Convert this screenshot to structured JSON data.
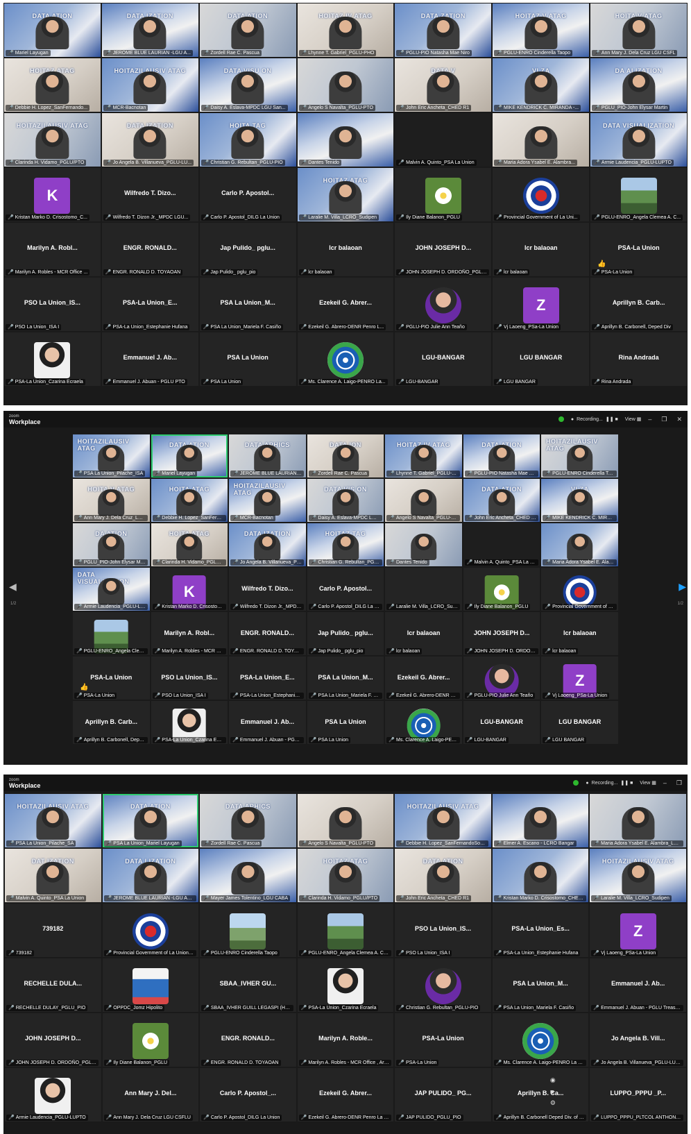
{
  "zoom": {
    "brand_small": "zoom",
    "brand": "Workplace",
    "recording": "Recording...",
    "view": "View"
  },
  "shot1": {
    "tiles": [
      {
        "caption": "Mariel Layugan",
        "banner": "DATA ATION",
        "type": "video"
      },
      {
        "caption": "JEROME BLUE LAURIAN -LGU A...",
        "banner": "DATA IZATION",
        "type": "video"
      },
      {
        "caption": "Zordell Rae C. Pascua",
        "banner": "DATA ATION",
        "type": "video"
      },
      {
        "caption": "Lhynne T. Gabriel_PGLU-PHO",
        "banner": "HOITAZ IV ATAG",
        "type": "video"
      },
      {
        "caption": "PGLU-PIO Natasha Mae Niro",
        "banner": "DATA ZATION",
        "type": "video"
      },
      {
        "caption": "PGLU-ENRO Cinderella Taopo",
        "banner": "HOITAZ V ATAG",
        "type": "video"
      },
      {
        "caption": "Ann Mary J. Dela Cruz LGU CSFL",
        "banner": "HOITA V ATAG",
        "type": "video"
      },
      {
        "caption": "Debbie H. Lopez_SanFernando...",
        "banner": "HOITAZ ATAG",
        "type": "video"
      },
      {
        "caption": "MCR-Bacnotan",
        "banner": "HOITAZILAUSIV ATAG",
        "type": "video"
      },
      {
        "caption": "Daisy A. Eslava-MPDC LGU San...",
        "banner": "DATA VISU ON",
        "type": "video"
      },
      {
        "caption": "Angelo S Navalta_PGLU-PTO",
        "banner": "",
        "type": "video"
      },
      {
        "caption": "John Eric Ancheta_CHED R1",
        "banner": "DATA V",
        "type": "video"
      },
      {
        "caption": "MIKE KENDRICK C. MIRANDA -...",
        "banner": "VI ZA",
        "type": "video"
      },
      {
        "caption": "PGLU_PIO-John Elysar Martin",
        "banner": "DA ALIZATION",
        "type": "video"
      },
      {
        "caption": "Clarinda H. Vidamo_PGLU/PTO",
        "banner": "HOITAZILAUSIV ATAG",
        "type": "video"
      },
      {
        "caption": "Jo Angela B. Villanueva_PGLU-LU...",
        "banner": "DATA IZATION",
        "type": "video"
      },
      {
        "caption": "Christian G. Rebultan_PGLU-PIO",
        "banner": "HOITA TAG",
        "type": "video"
      },
      {
        "caption": "Dantes Tenido",
        "banner": "",
        "type": "video"
      },
      {
        "caption": "Malvin A. Quinto_PSA La Union",
        "banner": "",
        "type": "blank"
      },
      {
        "caption": "Maria Adora Ysabel E. Alambra...",
        "banner": "",
        "type": "video"
      },
      {
        "caption": "Armie Laudencia_PGLU-LUPTO",
        "banner": "DATA VISUALIZATION",
        "type": "video"
      },
      {
        "caption": "Kristan Marko D. Crisostomo_C...",
        "name": "",
        "avatar": "K",
        "type": "letter"
      },
      {
        "caption": "Wilfredo T. Dizon Jr._MPDC LGU...",
        "name": "Wilfredo T. Dizo...",
        "type": "name"
      },
      {
        "caption": "Carlo P. Apostol_DILG La Union",
        "name": "Carlo P. Apostol...",
        "type": "name"
      },
      {
        "caption": "Laralie M. Villa_LCRO_Sudipen",
        "banner": "HOITAZ ATAG",
        "type": "video"
      },
      {
        "caption": "Ily Diane Balanon_PGLU",
        "avatar": "",
        "type": "flower"
      },
      {
        "caption": "Provincial Government of La Uni...",
        "avatar": "",
        "type": "seal"
      },
      {
        "caption": "PGLU-ENRO_Angela Clemea A. C...",
        "avatar": "",
        "type": "landscape"
      },
      {
        "caption": "Marilyn A. Robles - MCR Office ...",
        "name": "Marilyn A. Robl...",
        "type": "name"
      },
      {
        "caption": "ENGR. RONALD D. TOYAOAN",
        "name": "ENGR. RONALD...",
        "type": "name"
      },
      {
        "caption": "Jap Pulido_ pglu_pio",
        "name": "Jap Pulido_ pglu...",
        "type": "name"
      },
      {
        "caption": "lcr balaoan",
        "name": "lcr balaoan",
        "type": "name"
      },
      {
        "caption": "JOHN JOSEPH D. ORDOÑO_PGLU/P...",
        "name": "JOHN JOSEPH D...",
        "type": "name"
      },
      {
        "caption": "lcr balaoan",
        "name": "lcr balaoan",
        "type": "name"
      },
      {
        "caption": "PSA-La Union",
        "name": "PSA-La Union",
        "type": "name",
        "emoji": "👍"
      },
      {
        "caption": "PSO La Union_ISA I",
        "name": "PSO La Union_IS...",
        "type": "name"
      },
      {
        "caption": "PSA-La Union_Estephanie Hufana",
        "name": "PSA-La Union_E...",
        "type": "name"
      },
      {
        "caption": "PSA La Union_Mariela F. Casiño",
        "name": "PSA La Union_M...",
        "type": "name"
      },
      {
        "caption": "Ezekeil G. Abrero-DENR Penro L...",
        "name": "Ezekeil G. Abrer...",
        "type": "name"
      },
      {
        "caption": "PGLU-PIO Julie Ann Teaño",
        "avatar": "",
        "type": "photo"
      },
      {
        "caption": "Vj Laoeng_PSa-La Union",
        "avatar": "Z",
        "type": "letter"
      },
      {
        "caption": "Aprillyn B. Carbonell, Deped Div",
        "name": "Aprillyn B. Carb...",
        "type": "name"
      },
      {
        "caption": "PSA-La Union_Czarina Ecraela",
        "avatar": "",
        "type": "portrait"
      },
      {
        "caption": "Emmanuel J. Abuan - PGLU PTO",
        "name": "Emmanuel J. Ab...",
        "type": "name"
      },
      {
        "caption": "PSA La Union",
        "name": "PSA La Union",
        "type": "name"
      },
      {
        "caption": "Ms. Clarence A. Laigo-PENRO La...",
        "avatar": "",
        "type": "denr"
      },
      {
        "caption": "LGU-BANGAR",
        "name": "LGU-BANGAR",
        "type": "name"
      },
      {
        "caption": "LGU BANGAR",
        "name": "LGU BANGAR",
        "type": "name"
      },
      {
        "caption": "Rina Andrada",
        "name": "Rina Andrada",
        "type": "name"
      }
    ]
  },
  "shot2": {
    "page_indicator": "1/2",
    "tiles": [
      {
        "caption": "PSA La Union_Pilache_ISA",
        "banner": "HOITAZILAUSIV ATAG",
        "type": "video"
      },
      {
        "caption": "Mariel Layugan",
        "banner": "DATA ATION",
        "type": "video",
        "active": true
      },
      {
        "caption": "JEROME BLUE LAURIAN -LGU A...",
        "banner": "DATA APHICS",
        "type": "video"
      },
      {
        "caption": "Zordell Rae C. Pascua",
        "banner": "DATA ION",
        "type": "video"
      },
      {
        "caption": "Lhynne T. Gabriel_PGLU-PHO",
        "banner": "HOITAZ IV ATAG",
        "type": "video"
      },
      {
        "caption": "PGLU-PIO Natasha Mae Niro",
        "banner": "DATA ATION",
        "type": "video"
      },
      {
        "caption": "PGLU-ENRO Cinderella Taopo",
        "banner": "HOITAZILAUSIV ATAG",
        "type": "video"
      },
      {
        "caption": "Ann Mary J. Dela Cruz_LGU CSFLU",
        "banner": "HOITA V ATAG",
        "type": "video"
      },
      {
        "caption": "Debbie H. Lopez_SanFernandoS...",
        "banner": "HOITA ATAG",
        "type": "video"
      },
      {
        "caption": "MCR-Bacnotan",
        "banner": "HOITAZILAUSIV ATAG",
        "type": "video"
      },
      {
        "caption": "Daisy A. Eslava-MPDC LGU Sa...",
        "banner": "DATA VIS ON",
        "type": "video"
      },
      {
        "caption": "Angelo S Navalta_PGLU-PTO",
        "banner": "",
        "type": "video"
      },
      {
        "caption": "John Eric Ancheta_CHED R1",
        "banner": "DATA ATION",
        "type": "video"
      },
      {
        "caption": "MIKE KENDRICK C. MIRANDA -...",
        "banner": "VI ZA",
        "type": "video"
      },
      {
        "caption": "PGLU_PIO-John Elysar Martin",
        "banner": "DA ATION",
        "type": "video"
      },
      {
        "caption": "Clarinda H. Vidamo_PGLU/PTO",
        "banner": "HOITA ATAG",
        "type": "video"
      },
      {
        "caption": "Jo Angela B. Villanueva_PGLU-LU...",
        "banner": "DATA IZATION",
        "type": "video"
      },
      {
        "caption": "Christian G. Rebultan_PGLU-PIO",
        "banner": "HOITAZ TAG",
        "type": "video"
      },
      {
        "caption": "Dantes Tenido",
        "banner": "",
        "type": "video"
      },
      {
        "caption": "Malvin A. Quinto_PSA La Union",
        "banner": "",
        "type": "blank"
      },
      {
        "caption": "Maria Adora Ysabel E. Alambra...",
        "banner": "",
        "type": "video"
      },
      {
        "caption": "Armie Laudencia_PGLU-LUPTO",
        "banner": "DATA VISUALIZATION",
        "type": "video"
      },
      {
        "caption": "Kristan Marko D. Crisostomo_C...",
        "avatar": "K",
        "type": "letter"
      },
      {
        "caption": "Wilfredo T. Dizon Jr._MPDC LGU...",
        "name": "Wilfredo T. Dizo...",
        "type": "name"
      },
      {
        "caption": "Carlo P. Apostol_DILG La Union",
        "name": "Carlo P. Apostol...",
        "type": "name"
      },
      {
        "caption": "Laralie M. Villa_LCRO_Sudipen",
        "name": "",
        "type": "name"
      },
      {
        "caption": "Ily Diane Balanon_PGLU",
        "avatar": "",
        "type": "flower"
      },
      {
        "caption": "Provincial Government of La Uni...",
        "avatar": "",
        "type": "seal"
      },
      {
        "caption": "PGLU-ENRO_Angela Clemea A. C...",
        "avatar": "",
        "type": "landscape"
      },
      {
        "caption": "Marilyn A. Robles - MCR Office ...",
        "name": "Marilyn A. Robl...",
        "type": "name"
      },
      {
        "caption": "ENGR. RONALD D. TOYAOAN",
        "name": "ENGR. RONALD...",
        "type": "name"
      },
      {
        "caption": "Jap Pulido_ pglu_pio",
        "name": "Jap Pulido_ pglu...",
        "type": "name"
      },
      {
        "caption": "lcr balaoan",
        "name": "lcr balaoan",
        "type": "name"
      },
      {
        "caption": "JOHN JOSEPH D. ORDOÑO_PGLU/P...",
        "name": "JOHN JOSEPH D...",
        "type": "name"
      },
      {
        "caption": "lcr balaoan",
        "name": "lcr balaoan",
        "type": "name"
      },
      {
        "caption": "PSA-La Union",
        "name": "PSA-La Union",
        "type": "name",
        "emoji": "👍"
      },
      {
        "caption": "PSO La Union_ISA I",
        "name": "PSO La Union_IS...",
        "type": "name"
      },
      {
        "caption": "PSA-La Union_Estephanie Hufana",
        "name": "PSA-La Union_E...",
        "type": "name"
      },
      {
        "caption": "PSA La Union_Mariela F. Casiño",
        "name": "PSA La Union_M...",
        "type": "name"
      },
      {
        "caption": "Ezekeil G. Abrero-DENR Penro L...",
        "name": "Ezekeil G. Abrer...",
        "type": "name"
      },
      {
        "caption": "PGLU-PIO Julie Ann Teaño",
        "avatar": "",
        "type": "photo"
      },
      {
        "caption": "Vj Laoeng_PSa-La Union",
        "avatar": "Z",
        "type": "letter"
      },
      {
        "caption": "Aprillyn B. Carbonell, Deped Div ...",
        "name": "Aprillyn B. Carb...",
        "type": "name"
      },
      {
        "caption": "PSA-La Union_Czarina Ecraela",
        "avatar": "",
        "type": "portrait"
      },
      {
        "caption": "Emmanuel J. Abuan - PGLU PTO",
        "name": "Emmanuel J. Ab...",
        "type": "name"
      },
      {
        "caption": "PSA La Union",
        "name": "PSA La Union",
        "type": "name"
      },
      {
        "caption": "Ms. Clarence A. Laigo-PENRO La...",
        "avatar": "",
        "type": "denr"
      },
      {
        "caption": "LGU-BANGAR",
        "name": "LGU-BANGAR",
        "type": "name"
      },
      {
        "caption": "LGU BANGAR",
        "name": "LGU BANGAR",
        "type": "name"
      }
    ]
  },
  "shot3": {
    "tiles": [
      {
        "caption": "PSA La Union_Pilache_SA",
        "banner": "HOITAZILAUSIV ATAG",
        "type": "video"
      },
      {
        "caption": "PSA La Union_Mariel Layugan",
        "banner": "DATA ATION",
        "type": "video",
        "active": true
      },
      {
        "caption": "Zordell Rae C. Pascua",
        "banner": "DATA APHICS",
        "type": "video"
      },
      {
        "caption": "Angelo S Navalta_PGLU-PTO",
        "banner": "",
        "type": "video"
      },
      {
        "caption": "Debbie H. Lopez_SanFernandoSouthCIS",
        "banner": "HOITAZILAUSIV ATAG",
        "type": "video"
      },
      {
        "caption": "Elmer A. Escano - LCRO Bangar",
        "banner": "",
        "type": "video"
      },
      {
        "caption": "Maria Adora Ysabel E. Alambra_LGU...",
        "banner": "",
        "type": "video"
      },
      {
        "caption": "Malvin A. Quinto_PSA La Union",
        "banner": "DAT IZATION",
        "type": "video"
      },
      {
        "caption": "JEROME BLUE LAURIAN -LGU ARINGAY",
        "banner": "DATA LIZATION",
        "type": "video"
      },
      {
        "caption": "Mayer James Tolentino_LGU CABA",
        "banner": "",
        "type": "video"
      },
      {
        "caption": "Clarinda H. Vidamo_PGLU/PTO",
        "banner": "HOITAZ ATAG",
        "type": "video"
      },
      {
        "caption": "John Eric Ancheta_CHED R1",
        "banner": "DATA ATION",
        "type": "video"
      },
      {
        "caption": "Kristan Marko D. Crisostomo_CHED RO1",
        "banner": "",
        "type": "video"
      },
      {
        "caption": "Laralie M. Villa_LCRO_Sudipen",
        "banner": "HOITAZILAUSIV ATAG",
        "type": "video"
      },
      {
        "caption": "739182",
        "name": "739182",
        "type": "name"
      },
      {
        "caption": "Provincial Government of La Union Web ...",
        "avatar": "",
        "type": "seal"
      },
      {
        "caption": "PGLU-ENRO Cinderella Taopo",
        "avatar": "",
        "type": "hiker"
      },
      {
        "caption": "PGLU-ENRO_Angela Clemea A. Claro",
        "avatar": "",
        "type": "landscape"
      },
      {
        "caption": "PSO La Union_ISA I",
        "name": "PSO La Union_IS...",
        "type": "name"
      },
      {
        "caption": "PSA-La Union_Estephanie Hufana",
        "name": "PSA-La Union_Es...",
        "type": "name"
      },
      {
        "caption": "Vj Laoeng_PSa-La Union",
        "avatar": "Z",
        "type": "letter"
      },
      {
        "caption": "RECHELLE DULAY_PGLU_PIO",
        "name": "RECHELLE DULA...",
        "type": "name"
      },
      {
        "caption": "OPPDC_Jomz Hipolito",
        "avatar": "",
        "type": "blazer"
      },
      {
        "caption": "SBAA_IVHER GUILL LEGASPI (HOST)",
        "name": "SBAA_IVHER GU...",
        "type": "name"
      },
      {
        "caption": "PSA-La Union_Czarina Ecraela",
        "avatar": "",
        "type": "portrait"
      },
      {
        "caption": "Christian G. Rebultan_PGLU-PIO",
        "avatar": "",
        "type": "photo"
      },
      {
        "caption": "PSA La Union_Mariela F. Casiño",
        "name": "PSA La Union_M...",
        "type": "name"
      },
      {
        "caption": "Emmanuel J. Abuan - PGLU Treasury ...",
        "name": "Emmanuel J. Ab...",
        "type": "name"
      },
      {
        "caption": "JOHN JOSEPH D. ORDOÑO_PGLU/PTO",
        "name": "JOHN JOSEPH D...",
        "type": "name"
      },
      {
        "caption": "Ily Diane Balanon_PGLU",
        "avatar": "",
        "type": "flower"
      },
      {
        "caption": "ENGR. RONALD D. TOYAOAN",
        "name": "ENGR. RONALD...",
        "type": "name"
      },
      {
        "caption": "Marilyn A. Robles - MCR Office , Aringay...",
        "name": "Marilyn A. Roble...",
        "type": "name"
      },
      {
        "caption": "PSA-La Union",
        "name": "PSA-La Union",
        "type": "name"
      },
      {
        "caption": "Ms. Clarence A. Laigo-PENRO La Union",
        "avatar": "",
        "type": "denr"
      },
      {
        "caption": "Jo Angela B. Villanueva_PGLU-LUPTO",
        "name": "Jo Angela B. Vill...",
        "type": "name"
      },
      {
        "caption": "Armie Laudencia_PGLU-LUPTO",
        "avatar": "",
        "type": "portrait"
      },
      {
        "caption": "Ann Mary J. Dela Cruz LGU CSFLU",
        "name": "Ann Mary J. Del...",
        "type": "name"
      },
      {
        "caption": "Carlo P. Apostol_DILG La Union",
        "name": "Carlo P. Apostol_...",
        "type": "name"
      },
      {
        "caption": "Ezekeil G. Abrero-DENR Penro La Union",
        "name": "Ezekeil G. Abrer...",
        "type": "name"
      },
      {
        "caption": "JAP PULIDO_PGLU_PIO",
        "name": "JAP PULIDO_ PG...",
        "type": "name"
      },
      {
        "caption": "Aprillyn B. Carbonell Deped Div. of SFC",
        "name": "Aprillyn B. Ca...",
        "type": "name"
      },
      {
        "caption": "LUPPO_PPPU_PLTCOL ANTHONY C...",
        "name": "LUPPO_PPPU _P...",
        "type": "name"
      }
    ]
  }
}
